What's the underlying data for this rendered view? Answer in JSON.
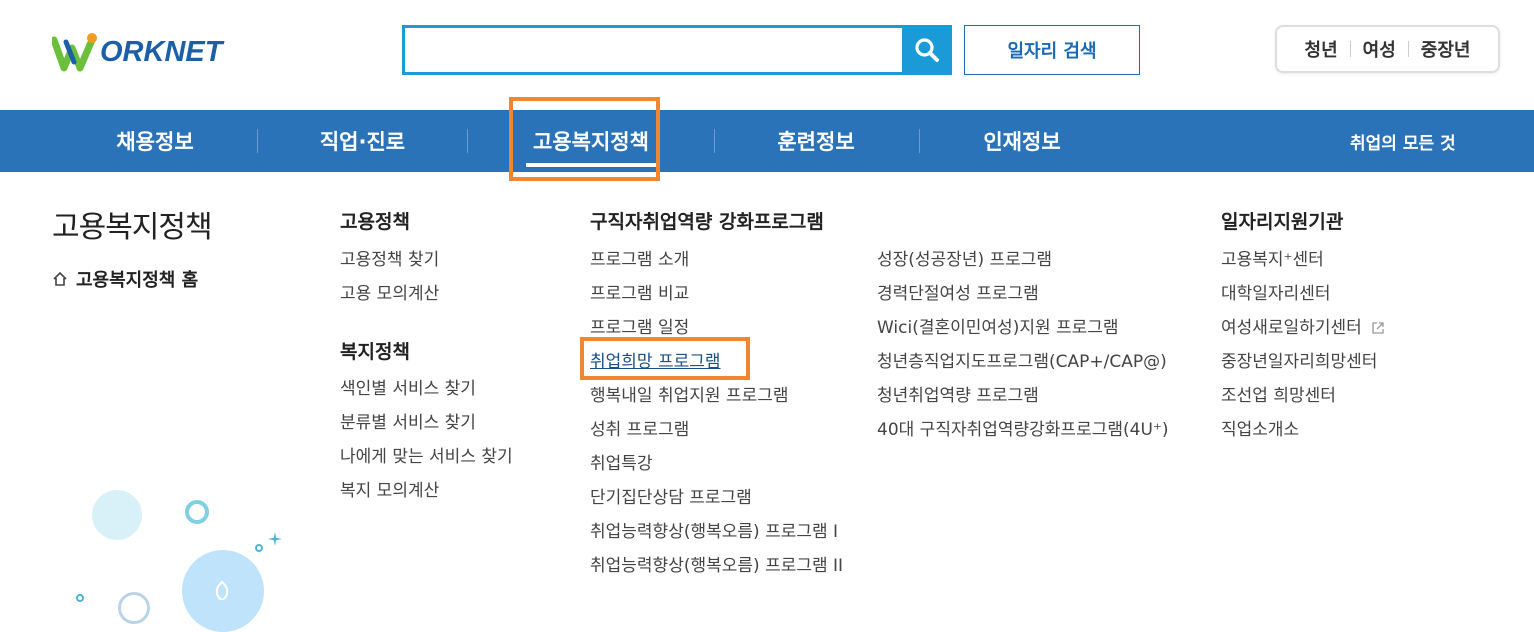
{
  "header": {
    "logo_text": "ORKNET",
    "search": {
      "value": "",
      "placeholder": "",
      "button_icon": "search-icon"
    },
    "job_search_label": "일자리 검색",
    "quick_links": [
      "청년",
      "여성",
      "중장년"
    ]
  },
  "gnb": {
    "items": [
      "채용정보",
      "직업·진로",
      "고용복지정책",
      "훈련정보",
      "인재정보"
    ],
    "active": "고용복지정책",
    "all_label": "취업의 모든 것"
  },
  "submenu": {
    "title": "고용복지정책",
    "home_label": "고용복지정책 홈",
    "employment_policy": {
      "heading": "고용정책",
      "links": [
        "고용정책 찾기",
        "고용 모의계산"
      ]
    },
    "welfare_policy": {
      "heading": "복지정책",
      "links": [
        "색인별 서비스 찾기",
        "분류별 서비스 찾기",
        "나에게 맞는 서비스 찾기",
        "복지 모의계산"
      ]
    },
    "program": {
      "heading": "구직자취업역량 강화프로그램",
      "links_col1": [
        "프로그램 소개",
        "프로그램 비교",
        "프로그램 일정",
        "취업희망 프로그램",
        "행복내일 취업지원 프로그램",
        "성취 프로그램",
        "취업특강",
        "단기집단상담 프로그램",
        "취업능력향상(행복오름) 프로그램 I",
        "취업능력향상(행복오름) 프로그램 II"
      ],
      "links_col2": [
        "성장(성공장년) 프로그램",
        "경력단절여성 프로그램",
        "Wici(결혼이민여성)지원 프로그램",
        "청년층직업지도프로그램(CAP+/CAP@)",
        "청년취업역량 프로그램",
        "40대 구직자취업역량강화프로그램(4U⁺)"
      ],
      "active_link": "취업희망 프로그램"
    },
    "agencies": {
      "heading": "일자리지원기관",
      "links": [
        "고용복지⁺센터",
        "대학일자리센터",
        "여성새로일하기센터",
        "중장년일자리희망센터",
        "조선업 희망센터",
        "직업소개소"
      ]
    }
  },
  "colors": {
    "nav_bg": "#2b73b8",
    "search_accent": "#1a9bd7",
    "highlight": "#f08532",
    "logo_blue": "#1b5fa8",
    "logo_green": "#6bbf3a"
  }
}
